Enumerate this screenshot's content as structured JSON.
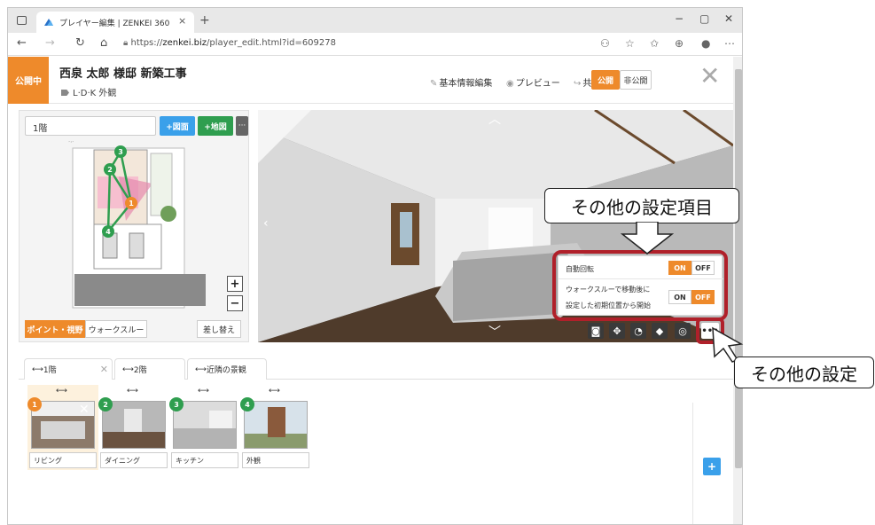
{
  "browser": {
    "tab_title": "プレイヤー編集 | ZENKEI 360",
    "tab_close": "×",
    "new_tab": "+",
    "url_prefix": "https://",
    "url_domain": "zenkei.biz",
    "url_path": "/player_edit.html?id=609278",
    "win_min": "−",
    "win_max": "▢",
    "win_close": "✕"
  },
  "header": {
    "status": "公開中",
    "title": "西泉 太郎 様邸 新築工事",
    "subtitle": "L·D·K 外観",
    "links": [
      "基本情報編集",
      "プレビュー",
      "共有"
    ],
    "public_label": "公開",
    "private_label": "非公開"
  },
  "map": {
    "floor_value": "1階",
    "add_plan_label": "+図面",
    "add_map_label": "+地図",
    "more_label": "···",
    "zoom_in": "+",
    "zoom_out": "−",
    "mode_point": "ポイント・視野",
    "mode_walk": "ウォークスルー",
    "replace_label": "差し替え",
    "point_numbers": [
      "1",
      "2",
      "3",
      "4"
    ]
  },
  "settings": {
    "auto_rotate_label": "自動回転",
    "auto_rotate_state": "ON",
    "walkthrough_label_1": "ウォークスルーで移動後に",
    "walkthrough_label_2": "設定した初期位置から開始",
    "walkthrough_state": "OFF",
    "on_label": "ON",
    "off_label": "OFF"
  },
  "callouts": {
    "other_items": "その他の設定項目",
    "other_settings": "その他の設定"
  },
  "floor_tabs": [
    {
      "label": "1階"
    },
    {
      "label": "2階"
    },
    {
      "label": "近隣の景観"
    }
  ],
  "thumbnails": [
    {
      "num": "1",
      "label": "リビング",
      "color": "#ee8a2b"
    },
    {
      "num": "2",
      "label": "ダイニング",
      "color": "#2f9e4f"
    },
    {
      "num": "3",
      "label": "キッチン",
      "color": "#2f9e4f"
    },
    {
      "num": "4",
      "label": "外観",
      "color": "#2f9e4f"
    }
  ],
  "colors": {
    "accent": "#ee8a2b",
    "green": "#2f9e4f",
    "blue": "#3aa0ea",
    "highlight_red": "#b0202a"
  }
}
